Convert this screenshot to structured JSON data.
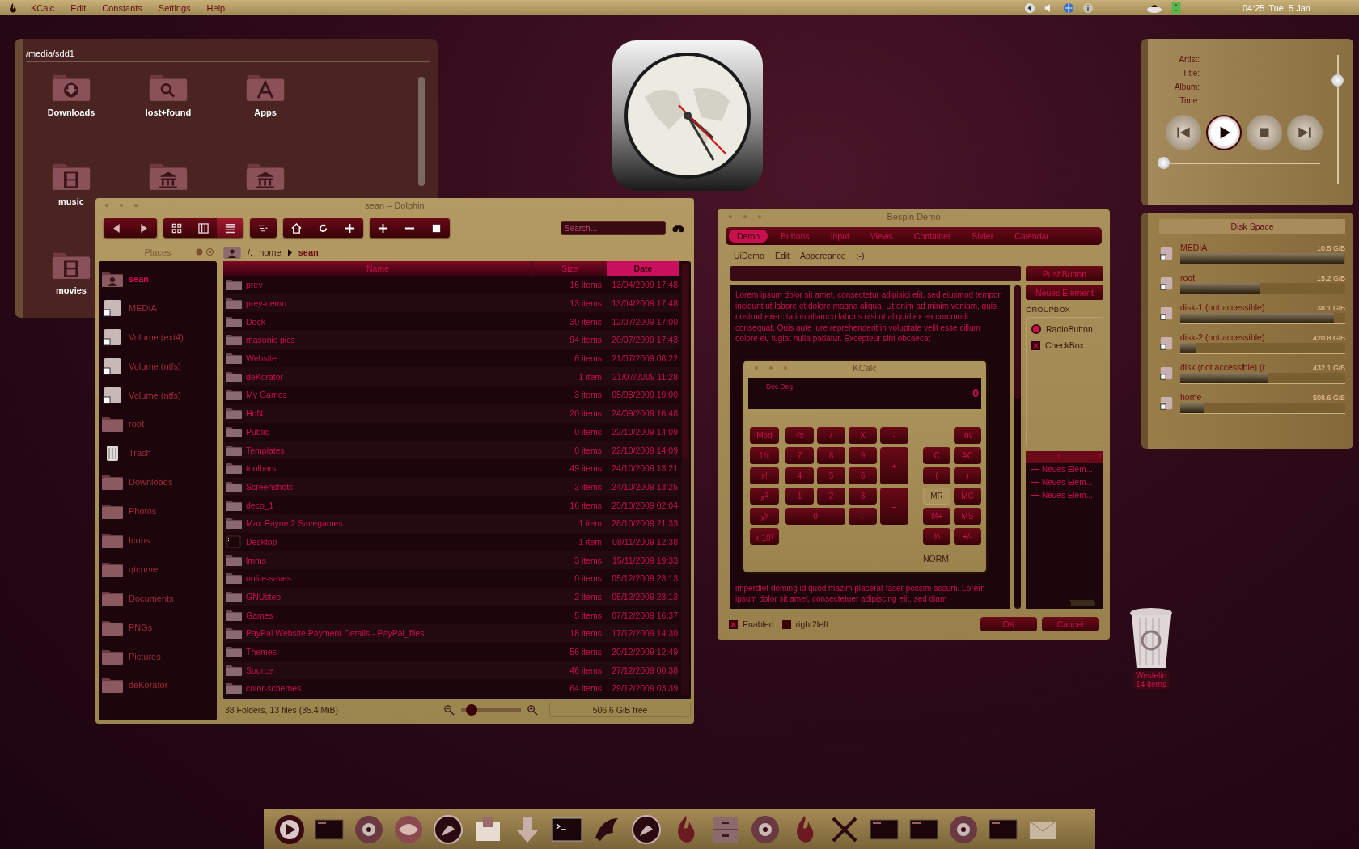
{
  "top_bar": {
    "menu": [
      "KCalc",
      "Edit",
      "Constants",
      "Settings",
      "Help"
    ],
    "time": "04:25",
    "date": "Tue, 5 Jan"
  },
  "folder_view": {
    "path": "/media/sdd1",
    "items": [
      {
        "label": "Downloads",
        "kind": "download"
      },
      {
        "label": "lost+found",
        "kind": "search"
      },
      {
        "label": "Apps",
        "kind": "apps"
      },
      {
        "label": "music",
        "kind": "film"
      },
      {
        "kind": "library"
      },
      {
        "kind": "library"
      },
      {
        "label": "movies",
        "kind": "film"
      }
    ]
  },
  "dolphin": {
    "title": "sean – Dolphin",
    "view_modes": [
      {
        "selected": false
      },
      {
        "selected": false
      },
      {
        "selected": true
      }
    ],
    "search": {
      "placeholder": "Search..."
    },
    "places_title": "Places",
    "places": [
      {
        "label": "sean",
        "kind": "user",
        "selected": true
      },
      {
        "label": "MEDIA",
        "kind": "drive",
        "selected": false
      },
      {
        "label": "Volume (ext4)",
        "kind": "drive",
        "selected": false
      },
      {
        "label": "Volume (ntfs)",
        "kind": "drive",
        "selected": false
      },
      {
        "label": "Volume (ntfs)",
        "kind": "drive",
        "selected": false
      },
      {
        "label": "root",
        "kind": "folder",
        "selected": false
      },
      {
        "label": "Trash",
        "kind": "trash",
        "selected": false
      },
      {
        "label": "Downloads",
        "kind": "folder",
        "selected": false
      },
      {
        "label": "Photos",
        "kind": "folder",
        "selected": false
      },
      {
        "label": "Icons",
        "kind": "folder",
        "selected": false
      },
      {
        "label": "qtcurve",
        "kind": "folder",
        "selected": false
      },
      {
        "label": "Documents",
        "kind": "folder",
        "selected": false
      },
      {
        "label": "PNGs",
        "kind": "folder",
        "selected": false
      },
      {
        "label": "Pictures",
        "kind": "folder",
        "selected": false
      },
      {
        "label": "deKorator",
        "kind": "folder",
        "selected": false
      }
    ],
    "breadcrumb": [
      "/.",
      "home",
      "sean"
    ],
    "columns": [
      {
        "label": "Name",
        "selected": false
      },
      {
        "label": "Size",
        "selected": false
      },
      {
        "label": "Date",
        "selected": true
      }
    ],
    "rows": [
      {
        "name": "prey",
        "size": "16 items",
        "date": "13/04/2009 17:48",
        "kind": "folder"
      },
      {
        "name": "prey-demo",
        "size": "13 items",
        "date": "13/04/2009 17:48",
        "kind": "folder"
      },
      {
        "name": "Dock",
        "size": "30 items",
        "date": "12/07/2009 17:00",
        "kind": "folder"
      },
      {
        "name": "masonic pics",
        "size": "94 items",
        "date": "20/07/2009 17:43",
        "kind": "folder"
      },
      {
        "name": "Website",
        "size": "6 items",
        "date": "21/07/2009 08:22",
        "kind": "folder"
      },
      {
        "name": "deKorator",
        "size": "1 item",
        "date": "21/07/2009 11:28",
        "kind": "folder"
      },
      {
        "name": "My Games",
        "size": "3 items",
        "date": "05/08/2009 19:00",
        "kind": "folder"
      },
      {
        "name": "HoN",
        "size": "20 items",
        "date": "24/09/2009 16:48",
        "kind": "folder"
      },
      {
        "name": "Public",
        "size": "0 items",
        "date": "22/10/2009 14:09",
        "kind": "folder"
      },
      {
        "name": "Templates",
        "size": "0 items",
        "date": "22/10/2009 14:09",
        "kind": "folder"
      },
      {
        "name": "toolbars",
        "size": "49 items",
        "date": "24/10/2009 13:21",
        "kind": "folder"
      },
      {
        "name": "Screenshots",
        "size": "2 items",
        "date": "24/10/2009 13:25",
        "kind": "folder"
      },
      {
        "name": "deco_1",
        "size": "16 items",
        "date": "25/10/2009 02:04",
        "kind": "folder"
      },
      {
        "name": "Max Payne 2 Savegames",
        "size": "1 item",
        "date": "28/10/2009 21:33",
        "kind": "folder"
      },
      {
        "name": "Desktop",
        "size": "1 item",
        "date": "08/11/2009 12:38",
        "kind": "desktop"
      },
      {
        "name": "lmms",
        "size": "3 items",
        "date": "15/11/2009 19:33",
        "kind": "folder"
      },
      {
        "name": "oolite-saves",
        "size": "0 items",
        "date": "05/12/2009 23:13",
        "kind": "folder"
      },
      {
        "name": "GNUstep",
        "size": "2 items",
        "date": "05/12/2009 23:13",
        "kind": "folder"
      },
      {
        "name": "Games",
        "size": "5 items",
        "date": "07/12/2009 16:37",
        "kind": "folder"
      },
      {
        "name": "PayPal Website Payment Details - PayPal_files",
        "size": "18 items",
        "date": "17/12/2009 14:30",
        "kind": "folder"
      },
      {
        "name": "Themes",
        "size": "56 items",
        "date": "20/12/2009 12:49",
        "kind": "folder"
      },
      {
        "name": "Source",
        "size": "46 items",
        "date": "27/12/2009 00:38",
        "kind": "folder"
      },
      {
        "name": "color-schemes",
        "size": "64 items",
        "date": "29/12/2009 03:39",
        "kind": "folder"
      }
    ],
    "status": "38 Folders, 13 files (35.4 MiB)",
    "zoom": {
      "level": 0.08
    },
    "free": "506.6 GiB free"
  },
  "bespin": {
    "title": "Bespin Demo",
    "tabs": [
      {
        "label": "Demo",
        "selected": true
      },
      {
        "label": "Buttons",
        "selected": false
      },
      {
        "label": "Input",
        "selected": false
      },
      {
        "label": "Views",
        "selected": false
      },
      {
        "label": "Container",
        "selected": false
      },
      {
        "label": "Slider",
        "selected": false
      },
      {
        "label": "Calendar",
        "selected": false
      }
    ],
    "menu": [
      "UiDemo",
      "Edit",
      "Appereance",
      ":-)"
    ],
    "text_top": "Lorem ipsum dolor sit amet, consectetur adipisici elit, sed eiusmod tempor incidunt ut labore et dolore magna aliqua. Ut enim ad minim veniam, quis nostrud exercitation ullamco laboris nisi ut aliquid ex ea commodi consequat. Quis aute iure reprehenderit in voluptate velit esse cillum dolore eu fugiat nulla pariatur. Excepteur sint obcaecat",
    "text_bottom": "imperdiet doming id quod mazim placerat facer possim assum. Lorem ipsum dolor sit amet, consectetuer adipiscing elit, sed diam",
    "push_button": "PushButton",
    "neues_button": "Neues Element",
    "groupbox": "GROUPBOX",
    "radio": {
      "label": "RadioButton",
      "selected": true
    },
    "checkbox": {
      "label": "CheckBox",
      "checked": true
    },
    "tree": {
      "columns": [
        "1",
        "2"
      ],
      "items": [
        "Neues Elem...",
        "Neues Elem...",
        "Neues Elem..."
      ]
    },
    "enabled": {
      "label": "Enabled",
      "checked": true
    },
    "right2left": {
      "label": "right2left",
      "checked": false
    },
    "buttons": [
      "OK",
      "Cancel"
    ]
  },
  "kcalc": {
    "title": "KCalc",
    "mode": "Dec Deg",
    "display": "0",
    "func_keys": [
      "Mod",
      "1/x",
      "x!",
      "x$^{2}$",
      "x$^{y}$",
      "x·10$^{y}$"
    ],
    "num_keys": [
      {
        "label": "√x",
        "kind": "normal"
      },
      {
        "label": "/",
        "kind": "normal"
      },
      {
        "label": "X",
        "kind": "normal"
      },
      {
        "label": "-",
        "kind": "normal"
      },
      {
        "label": "7",
        "kind": "normal"
      },
      {
        "label": "8",
        "kind": "normal"
      },
      {
        "label": "9",
        "kind": "normal"
      },
      {
        "label": "+",
        "kind": "tall"
      },
      {
        "label": "4",
        "kind": "normal"
      },
      {
        "label": "5",
        "kind": "normal"
      },
      {
        "label": "6",
        "kind": "normal"
      },
      {
        "label": "1",
        "kind": "normal"
      },
      {
        "label": "2",
        "kind": "normal"
      },
      {
        "label": "3",
        "kind": "normal"
      },
      {
        "label": "=",
        "kind": "tall"
      },
      {
        "label": "0",
        "kind": "wide"
      },
      {
        "label": ".",
        "kind": "normal"
      }
    ],
    "mem_keys": [
      {
        "label": "Inv",
        "kind": "normal"
      },
      {
        "label": "C",
        "kind": "normal"
      },
      {
        "label": "AC",
        "kind": "normal"
      },
      {
        "label": "(",
        "kind": "normal"
      },
      {
        "label": ")",
        "kind": "normal"
      },
      {
        "label": "MR",
        "kind": "flat"
      },
      {
        "label": "MC",
        "kind": "normal"
      },
      {
        "label": "M+",
        "kind": "normal"
      },
      {
        "label": "MS",
        "kind": "normal"
      },
      {
        "label": "%",
        "kind": "normal"
      },
      {
        "label": "+/-",
        "kind": "normal"
      }
    ],
    "status": "NORM"
  },
  "player": {
    "labels": [
      "Artist:",
      "Title:",
      "Album:",
      "Time:"
    ],
    "volume": {
      "level": 0.85
    },
    "position": {
      "level": 0
    }
  },
  "disk_space": {
    "title": "Disk Space",
    "disks": [
      {
        "name": "MEDIA",
        "size": "10.5 GiB",
        "level": 0.99
      },
      {
        "name": "root",
        "size": "15.2 GiB",
        "level": 0.48
      },
      {
        "name": "disk-1 (not accessible)",
        "size": "38.1 GiB",
        "level": 0.93
      },
      {
        "name": "disk-2 (not accessible)",
        "size": "420.8 GiB",
        "level": 0.1
      },
      {
        "name": "disk (not accessible) (r",
        "size": "432.1 GiB",
        "level": 0.53
      },
      {
        "name": "home",
        "size": "508.6 GiB",
        "level": 0.14
      }
    ]
  },
  "trash": {
    "label": "Westelin",
    "count": "14 items"
  }
}
